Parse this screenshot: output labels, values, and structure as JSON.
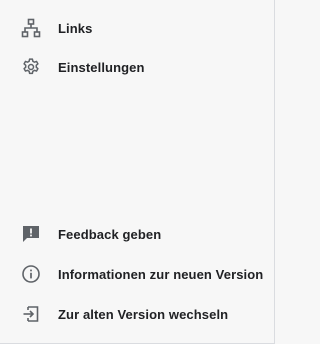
{
  "sidebar": {
    "top_items": [
      {
        "label": "Links",
        "icon": "sitemap-icon"
      },
      {
        "label": "Einstellungen",
        "icon": "gear-icon"
      }
    ],
    "bottom_items": [
      {
        "label": "Feedback geben",
        "icon": "feedback-icon"
      },
      {
        "label": "Informationen zur neuen Version",
        "icon": "info-icon"
      },
      {
        "label": "Zur alten Version wechseln",
        "icon": "switch-version-icon"
      }
    ]
  },
  "colors": {
    "background": "#f7f7f7",
    "text": "#202124",
    "icon": "#5f6368"
  }
}
